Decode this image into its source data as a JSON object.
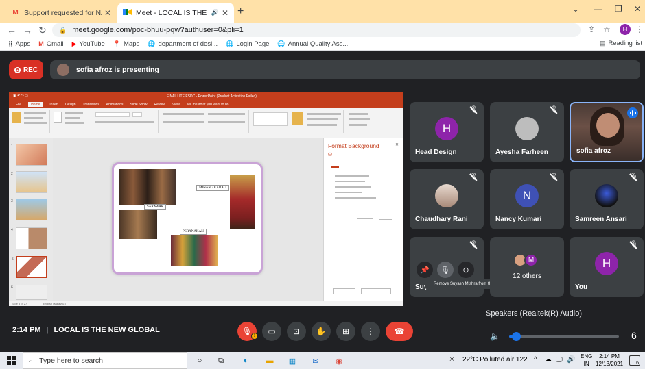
{
  "browser": {
    "tabs": [
      {
        "title": "Support requested for NAAC Cri",
        "icon": "gmail-icon"
      },
      {
        "title": "Meet - LOCAL IS THE NEW G",
        "icon": "meet-icon"
      }
    ],
    "url": "meet.google.com/poc-bhuu-pqw?authuser=0&pli=1",
    "profile_initial": "H",
    "bookmarks": [
      {
        "label": "Apps",
        "icon": "apps-grid-icon"
      },
      {
        "label": "Gmail",
        "icon": "gmail-icon"
      },
      {
        "label": "YouTube",
        "icon": "youtube-icon"
      },
      {
        "label": "Maps",
        "icon": "maps-pin-icon"
      },
      {
        "label": "department of desi...",
        "icon": "globe-icon"
      },
      {
        "label": "Login Page",
        "icon": "globe-icon"
      },
      {
        "label": "Annual Quality Ass...",
        "icon": "globe-icon"
      }
    ],
    "reading_list": "Reading list"
  },
  "meet": {
    "rec_label": "REC",
    "presenting_text": "sofia afroz is presenting",
    "time": "2:14 PM",
    "meeting_title": "LOCAL IS THE NEW GLOBAL",
    "participants": [
      {
        "name": "Head Design",
        "initial": "H",
        "color": "#8e24aa",
        "muted": true
      },
      {
        "name": "Ayesha Farheen",
        "initial": "",
        "color": "#9e9e9e",
        "muted": true
      },
      {
        "name": "sofia afroz",
        "initial": "",
        "color": "",
        "muted": false,
        "speaking": true
      },
      {
        "name": "Chaudhary Rani",
        "initial": "",
        "color": "",
        "muted": true
      },
      {
        "name": "Nancy Kumari",
        "initial": "N",
        "color": "#3f51b5",
        "muted": true
      },
      {
        "name": "Samreen Ansari",
        "initial": "",
        "color": "",
        "muted": true
      },
      {
        "name": "Suy",
        "initial": "",
        "color": "",
        "muted": true
      },
      {
        "name": "12 others",
        "initial": "M",
        "color": "#8e24aa",
        "muted": false
      },
      {
        "name": "You",
        "initial": "H",
        "color": "#8e24aa",
        "muted": true
      }
    ],
    "tooltip": "Remove Suyash Mishra from the call",
    "audio": {
      "label": "Speakers (Realtek(R) Audio)",
      "volume": 6,
      "volume_fraction": 0.06
    }
  },
  "slide": {
    "window_title": "FINAL LITE ESDC - PowerPoint (Product Activation Failed)",
    "ribbon_tabs": [
      "File",
      "Home",
      "Insert",
      "Design",
      "Transitions",
      "Animations",
      "Slide Show",
      "Review",
      "View",
      "Tell me what you want to do..."
    ],
    "selected_tab": "Home",
    "labels": [
      "SARAWAK",
      "MINANG KABAU",
      "PERANAKAN"
    ],
    "format_pane_title": "Format Background",
    "status_left": "Slide 5 of 27",
    "status_lang": "English (Malaysia)"
  },
  "taskbar": {
    "search_placeholder": "Type here to search",
    "weather": "22°C  Polluted air 122",
    "lang_line1": "ENG",
    "lang_line2": "IN",
    "clock_time": "2:14 PM",
    "clock_date": "12/13/2021",
    "notif_count": "6"
  },
  "colors": {
    "meet_bg": "#202124",
    "tile_bg": "#3c4043",
    "rec_red": "#d93025",
    "accent_blue": "#1a73e8",
    "ppt_orange": "#c43e1c",
    "chrome_tab_bar": "#ffe1a8"
  }
}
